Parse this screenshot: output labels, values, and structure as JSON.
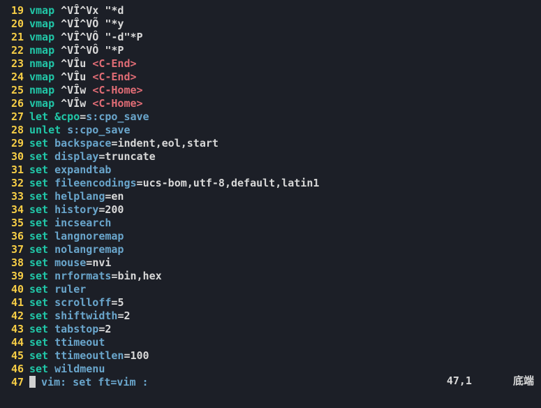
{
  "status": {
    "pos": "47,1",
    "tail": "底端"
  },
  "lines": [
    {
      "n": 19,
      "tokens": [
        [
          "kw",
          "vmap"
        ],
        [
          "str",
          " ^VÎ^Vx "
        ],
        [
          "str",
          "\"*d"
        ]
      ]
    },
    {
      "n": 20,
      "tokens": [
        [
          "kw",
          "vmap"
        ],
        [
          "str",
          " ^VÎ^VÕ "
        ],
        [
          "str",
          "\"*y"
        ]
      ]
    },
    {
      "n": 21,
      "tokens": [
        [
          "kw",
          "vmap"
        ],
        [
          "str",
          " ^VÎ^VÔ "
        ],
        [
          "str",
          "\"-d\"*P"
        ]
      ]
    },
    {
      "n": 22,
      "tokens": [
        [
          "kw",
          "nmap"
        ],
        [
          "str",
          " ^VÎ^VÔ "
        ],
        [
          "str",
          "\"*P"
        ]
      ]
    },
    {
      "n": 23,
      "tokens": [
        [
          "kw",
          "nmap"
        ],
        [
          "str",
          " ^VÎu "
        ],
        [
          "red",
          "<C-End>"
        ]
      ]
    },
    {
      "n": 24,
      "tokens": [
        [
          "kw",
          "vmap"
        ],
        [
          "str",
          " ^VÎu "
        ],
        [
          "red",
          "<C-End>"
        ]
      ]
    },
    {
      "n": 25,
      "tokens": [
        [
          "kw",
          "nmap"
        ],
        [
          "str",
          " ^VÎw "
        ],
        [
          "red",
          "<C-Home>"
        ]
      ]
    },
    {
      "n": 26,
      "tokens": [
        [
          "kw",
          "vmap"
        ],
        [
          "str",
          " ^VÎw "
        ],
        [
          "red",
          "<C-Home>"
        ]
      ]
    },
    {
      "n": 27,
      "tokens": [
        [
          "kw",
          "let"
        ],
        [
          "str",
          " "
        ],
        [
          "amp",
          "&cpo"
        ],
        [
          "eq",
          "="
        ],
        [
          "opt",
          "s:cpo_save"
        ]
      ]
    },
    {
      "n": 28,
      "tokens": [
        [
          "kw",
          "unlet"
        ],
        [
          "str",
          " "
        ],
        [
          "opt",
          "s:cpo_save"
        ]
      ]
    },
    {
      "n": 29,
      "tokens": [
        [
          "kw",
          "set"
        ],
        [
          "str",
          " "
        ],
        [
          "opt",
          "backspace"
        ],
        [
          "eq",
          "="
        ],
        [
          "val",
          "indent,eol,start"
        ]
      ]
    },
    {
      "n": 30,
      "tokens": [
        [
          "kw",
          "set"
        ],
        [
          "str",
          " "
        ],
        [
          "opt",
          "display"
        ],
        [
          "eq",
          "="
        ],
        [
          "val",
          "truncate"
        ]
      ]
    },
    {
      "n": 31,
      "tokens": [
        [
          "kw",
          "set"
        ],
        [
          "str",
          " "
        ],
        [
          "opt",
          "expandtab"
        ]
      ]
    },
    {
      "n": 32,
      "tokens": [
        [
          "kw",
          "set"
        ],
        [
          "str",
          " "
        ],
        [
          "opt",
          "fileencodings"
        ],
        [
          "eq",
          "="
        ],
        [
          "val",
          "ucs-bom,utf-8,default,latin1"
        ]
      ]
    },
    {
      "n": 33,
      "tokens": [
        [
          "kw",
          "set"
        ],
        [
          "str",
          " "
        ],
        [
          "opt",
          "helplang"
        ],
        [
          "eq",
          "="
        ],
        [
          "val",
          "en"
        ]
      ]
    },
    {
      "n": 34,
      "tokens": [
        [
          "kw",
          "set"
        ],
        [
          "str",
          " "
        ],
        [
          "opt",
          "history"
        ],
        [
          "eq",
          "="
        ],
        [
          "val",
          "200"
        ]
      ]
    },
    {
      "n": 35,
      "tokens": [
        [
          "kw",
          "set"
        ],
        [
          "str",
          " "
        ],
        [
          "opt",
          "incsearch"
        ]
      ]
    },
    {
      "n": 36,
      "tokens": [
        [
          "kw",
          "set"
        ],
        [
          "str",
          " "
        ],
        [
          "opt",
          "langnoremap"
        ]
      ]
    },
    {
      "n": 37,
      "tokens": [
        [
          "kw",
          "set"
        ],
        [
          "str",
          " "
        ],
        [
          "opt",
          "nolangremap"
        ]
      ]
    },
    {
      "n": 38,
      "tokens": [
        [
          "kw",
          "set"
        ],
        [
          "str",
          " "
        ],
        [
          "opt",
          "mouse"
        ],
        [
          "eq",
          "="
        ],
        [
          "val",
          "nvi"
        ]
      ]
    },
    {
      "n": 39,
      "tokens": [
        [
          "kw",
          "set"
        ],
        [
          "str",
          " "
        ],
        [
          "opt",
          "nrformats"
        ],
        [
          "eq",
          "="
        ],
        [
          "val",
          "bin,hex"
        ]
      ]
    },
    {
      "n": 40,
      "tokens": [
        [
          "kw",
          "set"
        ],
        [
          "str",
          " "
        ],
        [
          "opt",
          "ruler"
        ]
      ]
    },
    {
      "n": 41,
      "tokens": [
        [
          "kw",
          "set"
        ],
        [
          "str",
          " "
        ],
        [
          "opt",
          "scrolloff"
        ],
        [
          "eq",
          "="
        ],
        [
          "val",
          "5"
        ]
      ]
    },
    {
      "n": 42,
      "tokens": [
        [
          "kw",
          "set"
        ],
        [
          "str",
          " "
        ],
        [
          "opt",
          "shiftwidth"
        ],
        [
          "eq",
          "="
        ],
        [
          "val",
          "2"
        ]
      ]
    },
    {
      "n": 43,
      "tokens": [
        [
          "kw",
          "set"
        ],
        [
          "str",
          " "
        ],
        [
          "opt",
          "tabstop"
        ],
        [
          "eq",
          "="
        ],
        [
          "val",
          "2"
        ]
      ]
    },
    {
      "n": 44,
      "tokens": [
        [
          "kw",
          "set"
        ],
        [
          "str",
          " "
        ],
        [
          "opt",
          "ttimeout"
        ]
      ]
    },
    {
      "n": 45,
      "tokens": [
        [
          "kw",
          "set"
        ],
        [
          "str",
          " "
        ],
        [
          "opt",
          "ttimeoutlen"
        ],
        [
          "eq",
          "="
        ],
        [
          "val",
          "100"
        ]
      ]
    },
    {
      "n": 46,
      "tokens": [
        [
          "kw",
          "set"
        ],
        [
          "str",
          " "
        ],
        [
          "opt",
          "wildmenu"
        ]
      ]
    },
    {
      "n": 47,
      "cursor": true,
      "tokens": [
        [
          "com",
          " vim: set ft=vim :"
        ]
      ]
    }
  ]
}
